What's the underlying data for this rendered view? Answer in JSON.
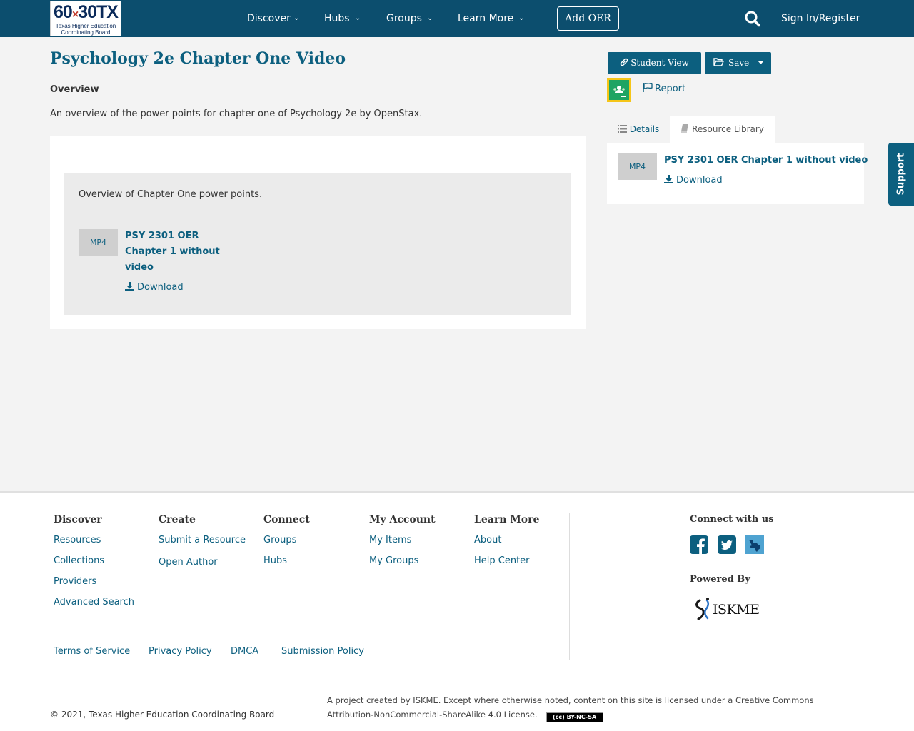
{
  "header": {
    "logo": {
      "big_left": "60",
      "big_x": "×",
      "big_right": "30TX",
      "small": "Texas Higher Education Coordinating Board"
    },
    "nav": [
      "Discover",
      "Hubs",
      "Groups",
      "Learn More"
    ],
    "add_oer": "Add OER",
    "signin": "Sign In/Register"
  },
  "main": {
    "title": "Psychology 2e Chapter One Video",
    "overview_heading": "Overview",
    "overview_text": "An overview of the power points for chapter one of Psychology 2e by OpenStax.",
    "card": {
      "text": "Overview of Chapter One power points.",
      "file": {
        "type": "MP4",
        "title": "PSY 2301 OER Chapter 1 without video",
        "download": "Download"
      }
    }
  },
  "sidebar": {
    "student_view": "Student View",
    "save": "Save",
    "report": "Report",
    "tabs": {
      "details": "Details",
      "library": "Resource Library"
    },
    "file": {
      "type": "MP4",
      "title": "PSY 2301 OER Chapter 1 without video",
      "download": "Download"
    },
    "support": "Support"
  },
  "footer": {
    "columns": [
      {
        "heading": "Discover",
        "links": [
          "Resources",
          "Collections",
          "Providers",
          "Advanced Search"
        ]
      },
      {
        "heading": "Create",
        "links": [
          "Submit a Resource",
          "Open Author"
        ]
      },
      {
        "heading": "Connect",
        "links": [
          "Groups",
          "Hubs"
        ]
      },
      {
        "heading": "My Account",
        "links": [
          "My Items",
          "My Groups"
        ]
      },
      {
        "heading": "Learn More",
        "links": [
          "About",
          "Help Center"
        ]
      }
    ],
    "legal": [
      "Terms of Service",
      "Privacy Policy",
      "DMCA",
      "Submission Policy"
    ],
    "connect_heading": "Connect with us",
    "powered_heading": "Powered By",
    "iskme": "ISKME",
    "copyright": "© 2021, Texas Higher Education Coordinating Board",
    "license": "A project created by ISKME. Except where otherwise noted, content on this site is licensed under a Creative Commons Attribution-NonCommercial-ShareAlike 4.0 License.",
    "cc_badge": "(cc) BY-NC-SA"
  },
  "colors": {
    "brand": "#0c4e6e",
    "accent": "#0c5f7f",
    "classroom_green": "#1fa463",
    "classroom_yellow": "#f5c518"
  }
}
